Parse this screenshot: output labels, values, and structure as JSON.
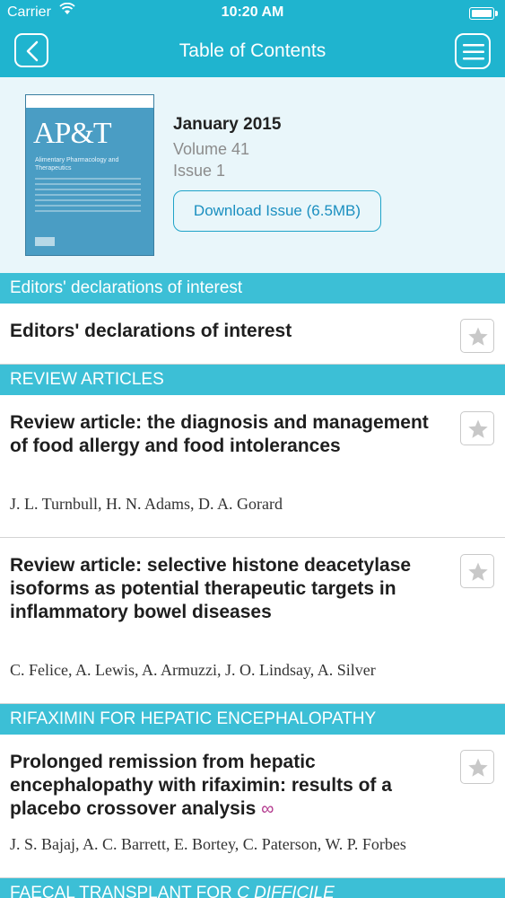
{
  "status_bar": {
    "carrier": "Carrier",
    "time": "10:20 AM"
  },
  "nav": {
    "title": "Table of Contents"
  },
  "issue": {
    "cover_logo": "AP&T",
    "cover_subtitle": "Alimentary Pharmacology and Therapeutics",
    "date": "January 2015",
    "volume": "Volume 41",
    "number": "Issue 1",
    "download_label": "Download Issue (6.5MB)"
  },
  "sections": [
    {
      "title": "Editors' declarations of interest"
    },
    {
      "title": "REVIEW ARTICLES"
    },
    {
      "title": "RIFAXIMIN FOR HEPATIC ENCEPHALOPATHY"
    },
    {
      "title_prefix": "FAECAL TRANSPLANT FOR ",
      "title_emph": "C DIFFICILE"
    }
  ],
  "articles": [
    {
      "title": "Editors' declarations of interest",
      "authors": ""
    },
    {
      "title": "Review article: the diagnosis and management of food allergy and food intolerances",
      "authors": "J. L. Turnbull, H. N. Adams, D. A. Gorard"
    },
    {
      "title": "Review article: selective histone deacetylase isoforms as potential therapeutic targets in inflammatory bowel diseases",
      "authors": "C. Felice, A. Lewis, A. Armuzzi, J. O. Lindsay, A. Silver"
    },
    {
      "title": "Prolonged remission from hepatic encephalopathy with rifaximin: results of a placebo crossover analysis",
      "authors": "J. S. Bajaj, A. C. Barrett, E. Bortey, C. Paterson, W. P. Forbes",
      "badge_icon": "open-access-icon"
    }
  ]
}
